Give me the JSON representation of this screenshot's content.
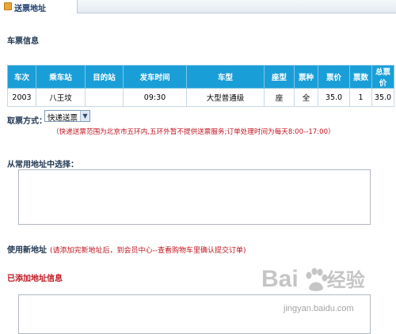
{
  "tab": {
    "label": "送票地址"
  },
  "ticket_section": {
    "title": "车票信息"
  },
  "table": {
    "headers": [
      "车次",
      "乘车站",
      "目的站",
      "发车时间",
      "车型",
      "座型",
      "票种",
      "票价",
      "票数",
      "总票价"
    ],
    "rows": [
      [
        "2003",
        "八王坟",
        "",
        "09:30",
        "大型普通级",
        "座",
        "全",
        "35.0",
        "1",
        "35.0"
      ]
    ]
  },
  "pickup": {
    "label": "取票方式：",
    "selected": "快递送票",
    "notice": "（快递送票范围为北京市五环内,五环外暂不提供送票服务;订单处理时间为每天8:00--17:00）"
  },
  "common_address": {
    "title": "从常用地址中选择："
  },
  "new_address": {
    "label": "使用新地址",
    "hint": "(请添加完新地址后，到会员中心--查看购物车里确认提交订单)"
  },
  "added_address": {
    "title": "已添加地址信息"
  },
  "watermark": {
    "main": "Bai",
    "suffix": "经验",
    "sub": "jingyan.baidu.com"
  }
}
